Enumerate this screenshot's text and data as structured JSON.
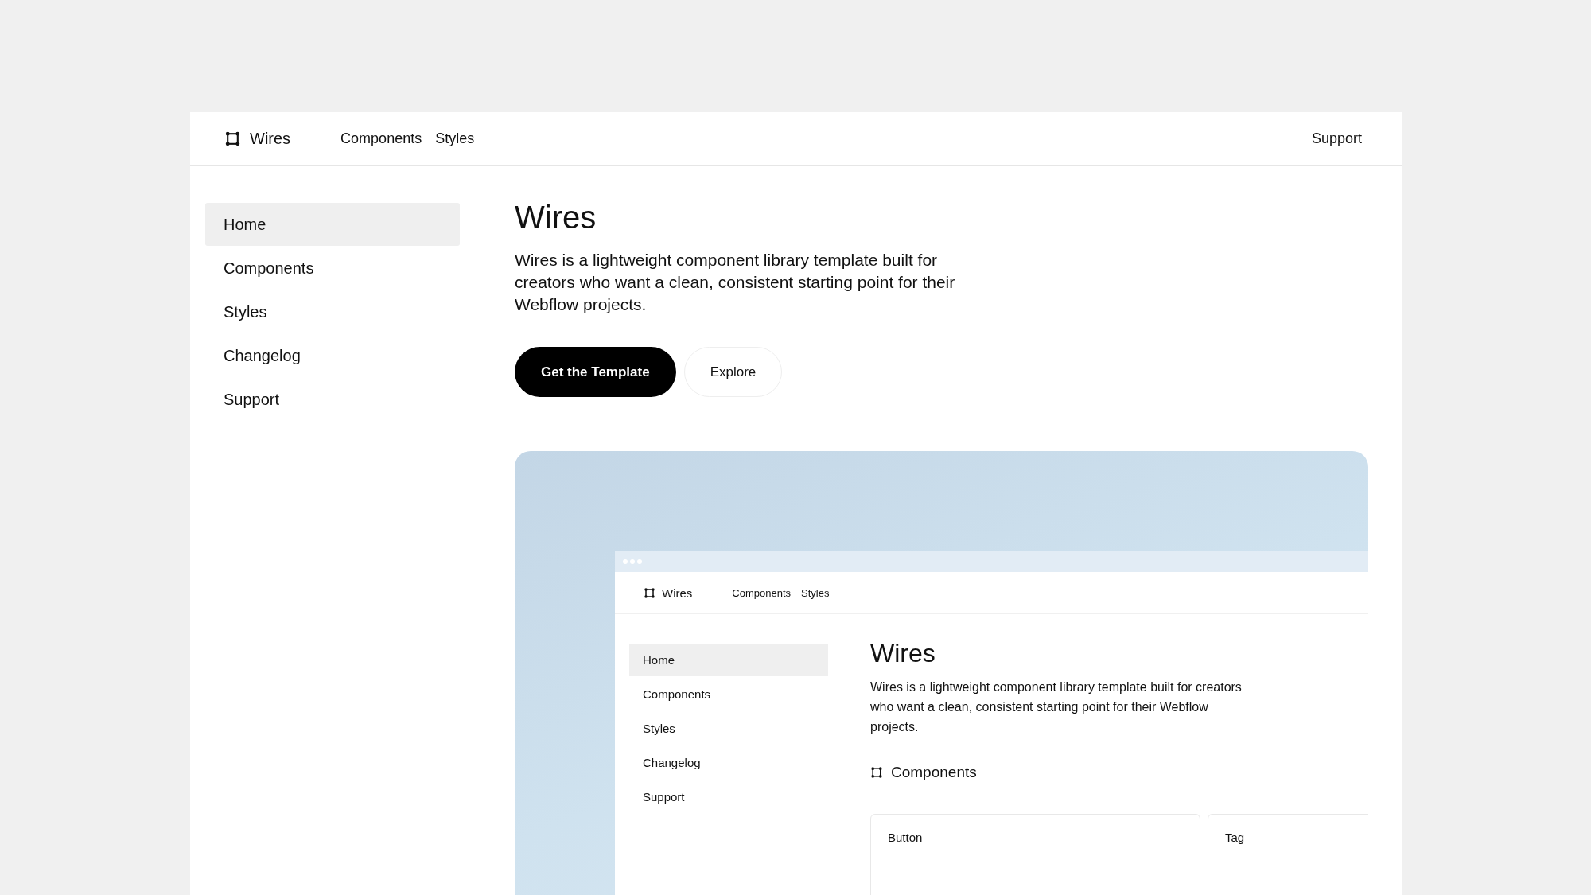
{
  "header": {
    "brand": "Wires",
    "nav": [
      {
        "label": "Components"
      },
      {
        "label": "Styles"
      }
    ],
    "support": "Support"
  },
  "sidebar": {
    "items": [
      {
        "label": "Home",
        "selected": true
      },
      {
        "label": "Components",
        "selected": false
      },
      {
        "label": "Styles",
        "selected": false
      },
      {
        "label": "Changelog",
        "selected": false
      },
      {
        "label": "Support",
        "selected": false
      }
    ]
  },
  "hero": {
    "title": "Wires",
    "description": "Wires is a lightweight component library template built for creators who want a clean, consistent starting point for their Webflow projects.",
    "buttons": [
      {
        "label": "Get the Template",
        "kind": "primary"
      },
      {
        "label": "Explore",
        "kind": "secondary"
      }
    ]
  },
  "preview": {
    "header": {
      "brand": "Wires",
      "nav": [
        {
          "label": "Components"
        },
        {
          "label": "Styles"
        }
      ]
    },
    "sidebar": {
      "items": [
        {
          "label": "Home",
          "selected": true
        },
        {
          "label": "Components",
          "selected": false
        },
        {
          "label": "Styles",
          "selected": false
        },
        {
          "label": "Changelog",
          "selected": false
        },
        {
          "label": "Support",
          "selected": false
        }
      ]
    },
    "title": "Wires",
    "description": "Wires is a lightweight component library template built for creators who want a clean, consistent starting point for their Webflow projects.",
    "section": "Components",
    "cards": [
      {
        "label": "Button"
      },
      {
        "label": "Tag"
      }
    ]
  }
}
